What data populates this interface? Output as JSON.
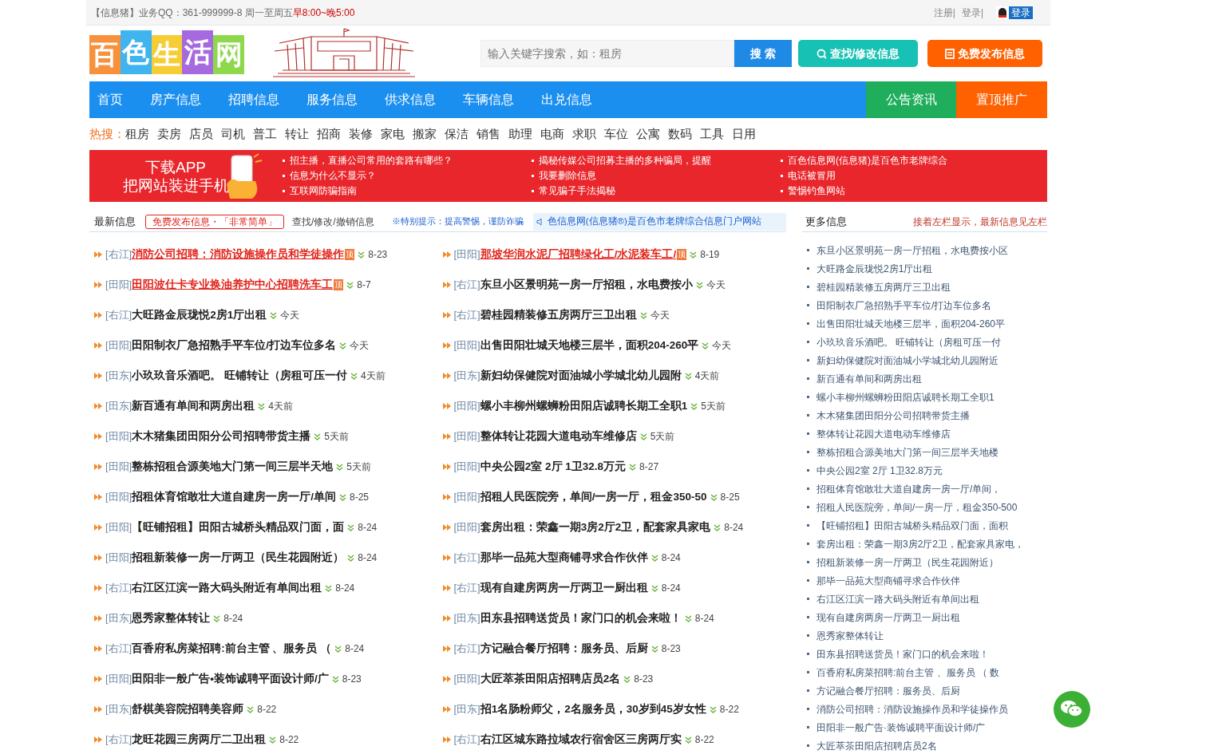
{
  "top_bar": {
    "brand": "【信息猪】",
    "contact": "业务QQ：361-999999-8 周一至周五",
    "hours": "早8:00~晚5:00",
    "links": [
      "注册|",
      "登录|"
    ],
    "qq_login": "登录"
  },
  "header": {
    "logo": "百色生活网",
    "search": {
      "placeholder": "输入关键字搜索，如：租房",
      "button": "搜 索"
    },
    "find_button": "查找/修改信息",
    "post_button": "免费发布信息"
  },
  "nav": {
    "items": [
      {
        "label": "首页",
        "kind": "main"
      },
      {
        "label": "房产信息",
        "kind": "main"
      },
      {
        "label": "招聘信息",
        "kind": "main"
      },
      {
        "label": "服务信息",
        "kind": "main"
      },
      {
        "label": "供求信息",
        "kind": "main"
      },
      {
        "label": "车辆信息",
        "kind": "main"
      },
      {
        "label": "出兑信息",
        "kind": "main"
      },
      {
        "label": "公告资讯",
        "kind": "news"
      },
      {
        "label": "置顶推广",
        "kind": "promo"
      }
    ]
  },
  "hot_search": {
    "label": "热搜：",
    "items": [
      "租房",
      "卖房",
      "店员",
      "司机",
      "普工",
      "转让",
      "招商",
      "装修",
      "家电",
      "搬家",
      "保洁",
      "销售",
      "助理",
      "电商",
      "求职",
      "车位",
      "公寓",
      "数码",
      "工具",
      "日用"
    ]
  },
  "banner": {
    "line1": "下载APP",
    "line2": "把网站装进手机",
    "columns": [
      [
        "招主播，直播公司常用的套路有哪些？",
        "信息为什么不显示？",
        "互联网防骗指南"
      ],
      [
        "揭秘传媒公司招募主播的多种骗局，提醒",
        "我要删除信息",
        "常见骗子手法揭秘"
      ],
      [
        "百色信息网(信息猪)是百色市老牌综合",
        "电话被冒用",
        "警惕钓鱼网站"
      ]
    ]
  },
  "latest": {
    "title": "最新信息",
    "post_link": "免费发布信息・「非常简单」",
    "manage_link": "查找/修改/撤销信息",
    "warning": "※特别提示：提高警惕，谨防诈骗",
    "ticker": "色信息网(信息猪®)是百色市老牌综合信息门户网站",
    "columns": [
      [
        {
          "region": "[右江]",
          "title": "消防公司招聘：消防设施操作员和学徒操作",
          "pinned": true,
          "badge": "顶",
          "date": "8-23"
        },
        {
          "region": "[田阳]",
          "title": "田阳波仕卡专业换油养护中心招聘洗车工",
          "pinned": true,
          "badge": "顶",
          "date": "8-7"
        },
        {
          "region": "[右江]",
          "title": "大旺路金辰珑悦2房1厅出租",
          "pinned": false,
          "date": "今天"
        },
        {
          "region": "[田阳]",
          "title": "田阳制衣厂急招熟手平车位/打边车位多名",
          "pinned": false,
          "date": "今天"
        },
        {
          "region": "[田东]",
          "title": "小玖玖音乐酒吧。 旺铺转让（房租可压一付",
          "pinned": false,
          "date": "4天前"
        },
        {
          "region": "[田东]",
          "title": "新百通有单间和两房出租",
          "pinned": false,
          "date": "4天前"
        },
        {
          "region": "[田阳]",
          "title": "木木猪集团田阳分公司招聘带货主播",
          "pinned": false,
          "date": "5天前"
        },
        {
          "region": "[田阳]",
          "title": "整栋招租合源美地大门第一间三层半天地",
          "pinned": false,
          "date": "5天前"
        },
        {
          "region": "[田阳]",
          "title": "招租体育馆敢壮大道自建房一房一厅/单间",
          "pinned": false,
          "date": "8-25"
        },
        {
          "region": "[田阳]",
          "title": "【旺铺招租】田阳古城桥头精品双门面，面",
          "pinned": false,
          "date": "8-24"
        },
        {
          "region": "[田阳]",
          "title": "招租新装修一房一厅两卫（民生花园附近）",
          "pinned": false,
          "date": "8-24"
        },
        {
          "region": "[右江]",
          "title": "右江区江滨一路大码头附近有单间出租",
          "pinned": false,
          "date": "8-24"
        },
        {
          "region": "[田东]",
          "title": "恩秀家整体转让",
          "pinned": false,
          "date": "8-24"
        },
        {
          "region": "[右江]",
          "title": "百香府私房菜招聘:前台主管 、服务员 （",
          "pinned": false,
          "date": "8-24"
        },
        {
          "region": "[田阳]",
          "title": "田阳非一般广告•装饰诚聘平面设计师/广",
          "pinned": false,
          "date": "8-23"
        },
        {
          "region": "[田东]",
          "title": "舒棋美容院招聘美容师",
          "pinned": false,
          "date": "8-22"
        },
        {
          "region": "[右江]",
          "title": "龙旺花园三房两厅二卫出租",
          "pinned": false,
          "date": "8-22"
        }
      ],
      [
        {
          "region": "[田阳]",
          "title": "那坡华润水泥厂招聘绿化工/水泥装车工/",
          "pinned": true,
          "badge": "顶",
          "date": "8-19"
        },
        {
          "region": "[右江]",
          "title": "东旦小区景明苑一房一厅招租，水电费按小",
          "pinned": false,
          "date": "今天"
        },
        {
          "region": "[右江]",
          "title": "碧桂园精装修五房两厅三卫出租",
          "pinned": false,
          "date": "今天"
        },
        {
          "region": "[田阳]",
          "title": "出售田阳壮城天地楼三层半，面积204-260平",
          "pinned": false,
          "date": "今天"
        },
        {
          "region": "[田东]",
          "title": "新妇幼保健院对面油城小学城北幼儿园附",
          "pinned": false,
          "date": "4天前"
        },
        {
          "region": "[田阳]",
          "title": "螺小丰柳州螺蛳粉田阳店诚聘长期工全职1",
          "pinned": false,
          "date": "5天前"
        },
        {
          "region": "[田阳]",
          "title": "整体转让花园大道电动车维修店",
          "pinned": false,
          "date": "5天前"
        },
        {
          "region": "[田阳]",
          "title": "中央公园2室 2厅 1卫32.8万元",
          "pinned": false,
          "date": "8-27"
        },
        {
          "region": "[田阳]",
          "title": "招租人民医院旁，单间/一房一厅，租金350-50",
          "pinned": false,
          "date": "8-25"
        },
        {
          "region": "[田阳]",
          "title": "套房出租：荣鑫一期3房2厅2卫，配套家具家电",
          "pinned": false,
          "date": "8-24"
        },
        {
          "region": "[右江]",
          "title": "那毕一品苑大型商铺寻求合作伙伴",
          "pinned": false,
          "date": "8-24"
        },
        {
          "region": "[右江]",
          "title": "现有自建房两房一厅两卫一厨出租",
          "pinned": false,
          "date": "8-24"
        },
        {
          "region": "[田东]",
          "title": "田东县招聘送货员！家门口的机会来啦！",
          "pinned": false,
          "date": "8-24"
        },
        {
          "region": "[右江]",
          "title": "方记融合餐厅招聘：服务员、后厨",
          "pinned": false,
          "date": "8-23"
        },
        {
          "region": "[田阳]",
          "title": "大匠萃茶田阳店招聘店员2名",
          "pinned": false,
          "date": "8-23"
        },
        {
          "region": "[田东]",
          "title": "招1名肠粉师父，2名服务员，30岁到45岁女性",
          "pinned": false,
          "date": "8-22"
        },
        {
          "region": "[右江]",
          "title": "右江区城东路拉域农行宿舍区三房两厅实",
          "pinned": false,
          "date": "8-22"
        }
      ]
    ]
  },
  "more": {
    "title": "更多信息",
    "note": "接着左栏显示，最新信息见左栏",
    "items": [
      "东旦小区景明苑一房一厅招租，水电费按小区",
      "大旺路金辰珑悦2房1厅出租",
      "碧桂园精装修五房两厅三卫出租",
      "田阳制衣厂急招熟手平车位/打边车位多名",
      "出售田阳壮城天地楼三层半，面积204-260平",
      "小玖玖音乐酒吧。 旺铺转让（房租可压一付",
      "新妇幼保健院对面油城小学城北幼儿园附近",
      "新百通有单间和两房出租",
      "螺小丰柳州螺蛳粉田阳店诚聘长期工全职1",
      "木木猪集团田阳分公司招聘带货主播",
      "整体转让花园大道电动车维修店",
      "整栋招租合源美地大门第一间三层半天地楼",
      "中央公园2室 2厅 1卫32.8万元",
      "招租体育馆敢壮大道自建房一房一厅/单间，",
      "招租人民医院旁，单间/一房一厅，租金350-500",
      "【旺铺招租】田阳古城桥头精品双门面，面积",
      "套房出租：荣鑫一期3房2厅2卫，配套家具家电，",
      "招租新装修一房一厅两卫（民生花园附近）",
      "那毕一品苑大型商铺寻求合作伙伴",
      "右江区江滨一路大码头附近有单间出租",
      "现有自建房两房一厅两卫一厨出租",
      "恩秀家整体转让",
      "田东县招聘送货员！家门口的机会来啦！",
      "百香府私房菜招聘:前台主管 、服务员 （ 数",
      "方记融合餐厅招聘：服务员、后厨",
      "消防公司招聘：消防设施操作员和学徒操作员",
      "田阳非一般广告·装饰诚聘平面设计师/广",
      "大匠萃茶田阳店招聘店员2名"
    ]
  }
}
